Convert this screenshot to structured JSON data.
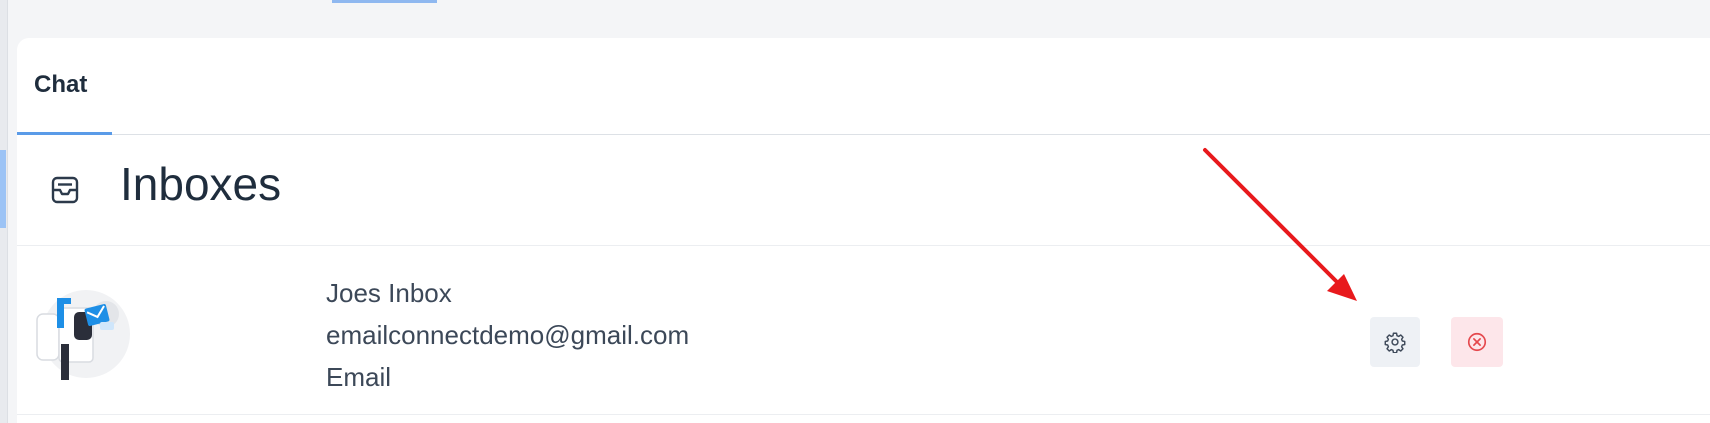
{
  "tabs": [
    {
      "label": "Chat",
      "active": true
    }
  ],
  "header": {
    "title": "Inboxes",
    "icon": "inbox-icon"
  },
  "inboxes": [
    {
      "name": "Joes Inbox",
      "email": "emailconnectdemo@gmail.com",
      "channel": "Email",
      "avatar": "mailbox-illustration",
      "actions": {
        "settings_icon": "gear-icon",
        "delete_icon": "close-circle-icon"
      }
    }
  ],
  "annotation": {
    "type": "red-arrow",
    "color": "#e8191c",
    "points_to": "settings-button"
  },
  "colors": {
    "accent": "#5a9be8",
    "delete_bg": "#fde6ea",
    "delete_fg": "#e5484d",
    "settings_bg": "#eef1f5"
  }
}
